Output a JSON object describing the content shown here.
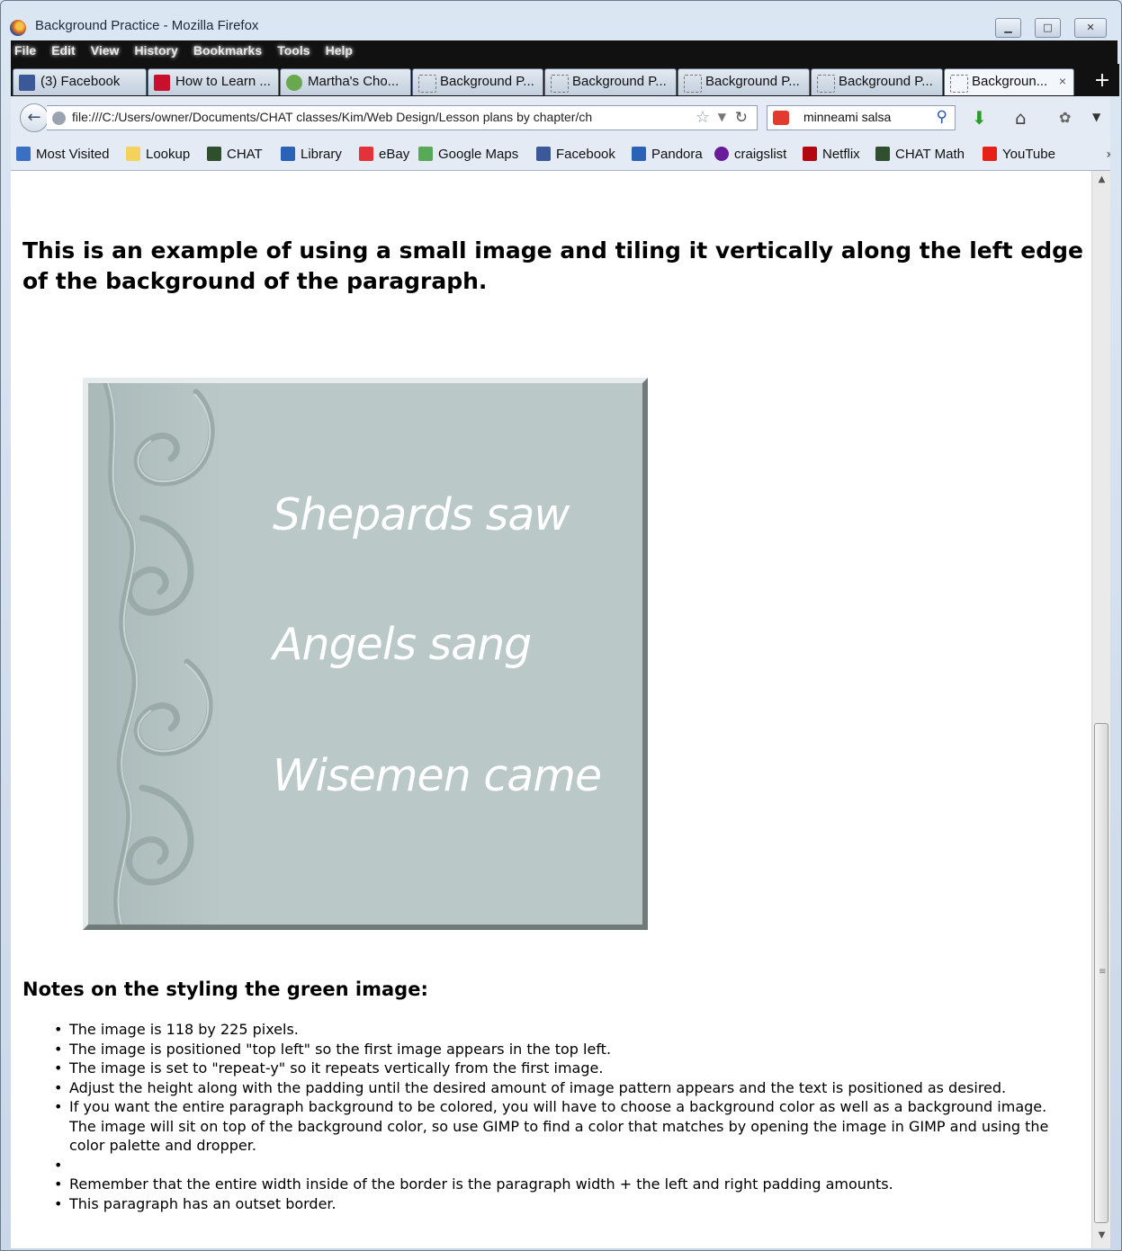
{
  "window": {
    "title": "Background Practice - Mozilla Firefox",
    "controls": {
      "minimize": "▁",
      "maximize": "□",
      "close": "✕"
    }
  },
  "menu": [
    "File",
    "Edit",
    "View",
    "History",
    "Bookmarks",
    "Tools",
    "Help"
  ],
  "tabs": [
    {
      "label": "(3) Facebook",
      "icon": "facebook-icon",
      "color": "#3b5998"
    },
    {
      "label": "How to Learn ...",
      "icon": "s-icon",
      "color": "#c8102e"
    },
    {
      "label": "Martha's Cho...",
      "icon": "tree-icon",
      "color": "#6aa84f"
    },
    {
      "label": "Background P...",
      "icon": "blank-page-icon",
      "color": "#ffffff"
    },
    {
      "label": "Background P...",
      "icon": "blank-page-icon",
      "color": "#ffffff"
    },
    {
      "label": "Background P...",
      "icon": "blank-page-icon",
      "color": "#ffffff"
    },
    {
      "label": "Background P...",
      "icon": "blank-page-icon",
      "color": "#ffffff"
    },
    {
      "label": "Backgroun...",
      "icon": "blank-page-icon",
      "color": "#ffffff",
      "active": true
    }
  ],
  "tab_close": "×",
  "new_tab": "+",
  "nav": {
    "url": "file:///C:/Users/owner/Documents/CHAT classes/Kim/Web Design/Lesson plans by chapter/ch",
    "search_value": "minneami salsa"
  },
  "bookmarks": [
    {
      "label": "Most Visited",
      "color": "#3a6fc4"
    },
    {
      "label": "Lookup",
      "color": "#f3d35b"
    },
    {
      "label": "CHAT",
      "color": "#2f4f2f"
    },
    {
      "label": "Library",
      "color": "#2a62b8"
    },
    {
      "label": "eBay",
      "color": "#e53238"
    },
    {
      "label": "Google Maps",
      "color": "#57a957"
    },
    {
      "label": "Facebook",
      "color": "#3b5998"
    },
    {
      "label": "Pandora",
      "color": "#2a62b8"
    },
    {
      "label": "craigslist",
      "color": "#6a1b9a"
    },
    {
      "label": "Netflix",
      "color": "#b20710"
    },
    {
      "label": "CHAT Math",
      "color": "#2f4f2f"
    },
    {
      "label": "YouTube",
      "color": "#e62117"
    }
  ],
  "bookmarks_more": "»",
  "page": {
    "heading": "This is an example of using a small image and tiling it vertically along the left edge of the background of the paragraph.",
    "card_lines": [
      "Shepards saw",
      "Angels sang",
      "Wisemen came"
    ],
    "card_color": "#bac9c8",
    "notes_heading": "Notes on the styling the green image:",
    "notes": [
      "The image is 118 by 225 pixels.",
      "The image is positioned \"top left\" so the first image appears in the top left.",
      "The image is set to \"repeat-y\" so it repeats vertically from the first image.",
      "Adjust the height along with the padding until the desired amount of image pattern appears and the text is positioned as desired.",
      "If you want the entire paragraph background to be colored, you will have to choose a background color as well as a background image. The image will sit on top of the background color, so use GIMP to find a color that matches by opening the image in GIMP and using the color palette and dropper.",
      "",
      "Remember that the entire width inside of the border is the paragraph width + the left and right padding amounts.",
      "This paragraph has an outset border."
    ]
  }
}
